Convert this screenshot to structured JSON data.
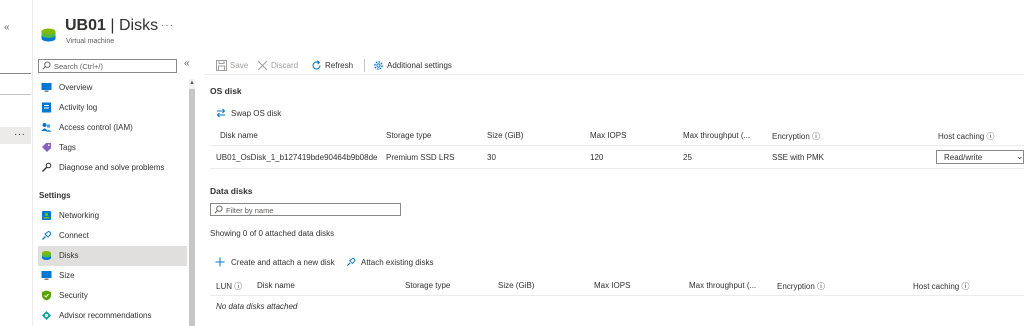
{
  "window": {
    "collapse_left": "«",
    "more_dots": "···"
  },
  "header": {
    "title_bold": "UB01",
    "title_rest": " | Disks",
    "subtitle": "Virtual machine",
    "more": "···"
  },
  "sidebar": {
    "search_placeholder": "Search (Ctrl+/)",
    "collapse": "«",
    "items_top": [
      {
        "label": "Overview",
        "icon": "monitor-icon"
      },
      {
        "label": "Activity log",
        "icon": "activity-log-icon"
      },
      {
        "label": "Access control (IAM)",
        "icon": "people-icon"
      },
      {
        "label": "Tags",
        "icon": "tag-icon"
      },
      {
        "label": "Diagnose and solve problems",
        "icon": "wrench-icon"
      }
    ],
    "settings_heading": "Settings",
    "items_settings": [
      {
        "label": "Networking",
        "icon": "network-icon"
      },
      {
        "label": "Connect",
        "icon": "connect-icon"
      },
      {
        "label": "Disks",
        "icon": "disks-icon",
        "selected": true
      },
      {
        "label": "Size",
        "icon": "size-icon"
      },
      {
        "label": "Security",
        "icon": "shield-icon"
      },
      {
        "label": "Advisor recommendations",
        "icon": "advisor-icon"
      }
    ]
  },
  "toolbar": {
    "save": "Save",
    "discard": "Discard",
    "refresh": "Refresh",
    "additional_settings": "Additional settings"
  },
  "os_disk": {
    "title": "OS disk",
    "swap_label": "Swap OS disk",
    "columns": {
      "disk_name": "Disk name",
      "storage_type": "Storage type",
      "size": "Size (GiB)",
      "max_iops": "Max IOPS",
      "max_throughput": "Max throughput (...",
      "encryption": "Encryption ⓘ",
      "host_caching": "Host caching ⓘ"
    },
    "row": {
      "disk_name": "UB01_OsDisk_1_b127419bde90464b9b08de",
      "storage_type": "Premium SSD LRS",
      "size": "30",
      "max_iops": "120",
      "max_throughput": "25",
      "encryption": "SSE with PMK",
      "host_caching": "Read/write"
    }
  },
  "data_disks": {
    "title": "Data disks",
    "filter_placeholder": "Filter by name",
    "showing": "Showing 0 of 0 attached data disks",
    "create_label": "Create and attach a new disk",
    "attach_label": "Attach existing disks",
    "columns": {
      "lun": "LUN ⓘ",
      "disk_name": "Disk name",
      "storage_type": "Storage type",
      "size": "Size (GiB)",
      "max_iops": "Max IOPS",
      "max_throughput": "Max throughput (...",
      "encryption": "Encryption ⓘ",
      "host_caching": "Host caching ⓘ"
    },
    "empty": "No data disks attached"
  },
  "colors": {
    "accent": "#0f6cbd",
    "selected_bg": "#e1dfdd"
  }
}
